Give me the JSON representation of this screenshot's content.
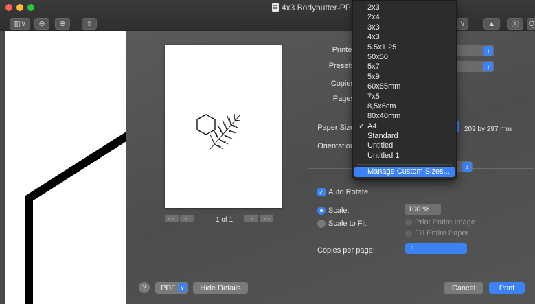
{
  "window": {
    "title": "4x3 Bodybutter-PP"
  },
  "toolbar": {
    "sidebar_btn": "▥∨",
    "zoom_out": "⊖",
    "zoom_in": "⊕",
    "share": "⇧",
    "right_chevron": "∨",
    "right_btn_a": "▲",
    "right_btn_b": "Ⓐ",
    "right_btn_c": "Q"
  },
  "print": {
    "printer_label": "Printer",
    "presets_label": "Presets",
    "copies_label": "Copies",
    "pages_label": "Pages",
    "paper_size_label": "Paper Size",
    "paper_size_dims": "209 by 297 mm",
    "orientation_label": "Orientation",
    "auto_rotate": {
      "label": "Auto Rotate",
      "checked": true
    },
    "scale_label": "Scale:",
    "scale_value": "100 %",
    "scale_to_fit_label": "Scale to Fit:",
    "print_entire_image": "Print Entire Image",
    "fill_entire_paper": "Fill Entire Paper",
    "copies_per_page_label": "Copies per page:",
    "copies_per_page_value": "1",
    "page_indicator": "1 of 1",
    "pager_first": "<<",
    "pager_prev": "<",
    "pager_next": ">",
    "pager_last": ">>",
    "help": "?",
    "pdf_button": "PDF",
    "hide_details": "Hide Details",
    "cancel": "Cancel",
    "print": "Print"
  },
  "paper_size_menu": {
    "items": [
      {
        "label": "2x3"
      },
      {
        "label": "2x4"
      },
      {
        "label": "3x3"
      },
      {
        "label": "4x3"
      },
      {
        "label": "5.5x1.25"
      },
      {
        "label": "50x50"
      },
      {
        "label": "5x7"
      },
      {
        "label": "5x9"
      },
      {
        "label": "60x85mm"
      },
      {
        "label": "7x5"
      },
      {
        "label": "8,5x6cm"
      },
      {
        "label": "80x40mm"
      },
      {
        "label": "A4",
        "checked": true
      },
      {
        "label": "Standard"
      },
      {
        "label": "Untitled"
      },
      {
        "label": "Untitled 1"
      }
    ],
    "check_mark": "✓",
    "manage": "Manage Custom Sizes..."
  },
  "colors": {
    "accent": "#3b82f6",
    "sheet": "#555555",
    "menu": "#2c2c2c"
  },
  "icons": [
    "document-icon",
    "sidebar-toggle-icon",
    "zoom-out-icon",
    "zoom-in-icon",
    "share-icon",
    "help-icon",
    "checkmark-icon",
    "chevron-updown-icon"
  ]
}
